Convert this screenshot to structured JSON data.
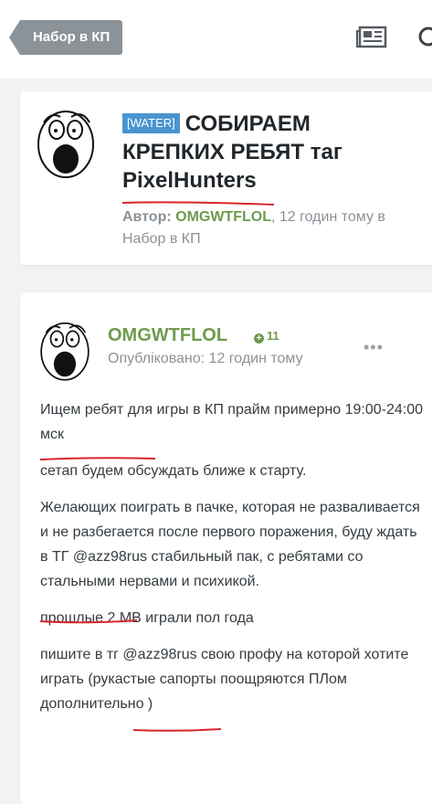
{
  "header": {
    "back_label": "Набор в КП",
    "icons": [
      "newspaper-icon",
      "search-icon"
    ]
  },
  "topic": {
    "tag": "[WATER]",
    "title": "СОБИРАЕМ КРЕПКИХ РЕБЯТ таг PixelHunters",
    "author_label": "Автор:",
    "author": "OMGWTFLOL",
    "time": ", 12 годин тому в",
    "forum": "Набор в КП"
  },
  "post": {
    "username": "OMGWTFLOL",
    "reputation": "11",
    "published": "Опубліковано: 12 годин тому",
    "menu": "•••",
    "paragraphs": [
      "Ищем ребят для игры в КП прайм примерно 19:00-24:00 мск",
      "сетап будем обсуждать ближе к старту.",
      "Желающих поиграть в пачке, которая не разваливается и не разбегается после первого поражения,  буду ждать в ТГ @azz98rus  стабильный пак, с ребятами со стальными нервами и психикой.",
      "прошлые 2 МВ играли пол года",
      "пишите в тг @azz98rus  свою профу на которой хотите играть (рукастые сапорты поощряются ПЛом дополнительно )"
    ]
  },
  "colors": {
    "accent_green": "#6f9a4e",
    "tag_blue": "#4a94cf",
    "annotation_red": "#d9262b"
  }
}
